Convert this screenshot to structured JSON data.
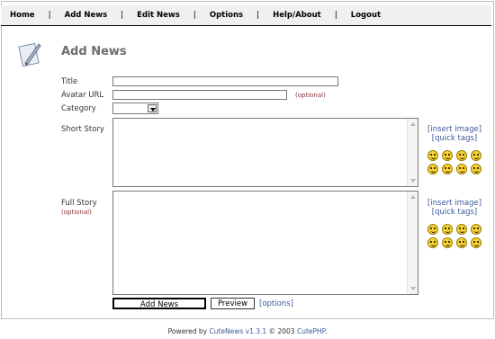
{
  "nav": {
    "items": [
      "Home",
      "Add News",
      "Edit News",
      "Options",
      "Help/About",
      "Logout"
    ]
  },
  "page": {
    "title": "Add News"
  },
  "form": {
    "title_label": "Title",
    "title_value": "",
    "avatar_label": "Avatar URL",
    "avatar_value": "",
    "avatar_optional": "(optional)",
    "category_label": "Category",
    "category_value": "",
    "short_story_label": "Short Story",
    "full_story_label": "Full Story",
    "full_story_optional": "(optional)",
    "insert_image": "[insert image]",
    "quick_tags": "[quick tags]",
    "add_news_button": "Add News",
    "preview_button": "Preview",
    "options_link": "[options]"
  },
  "footer": {
    "prefix": "Powered by",
    "product": "CuteNews v1.3.1",
    "copyright": "© 2003",
    "company": "CutePHP",
    "suffix": "."
  },
  "colors": {
    "link": "#3b5998",
    "title": "#6e6e6e",
    "smiley": "#f7d233"
  }
}
